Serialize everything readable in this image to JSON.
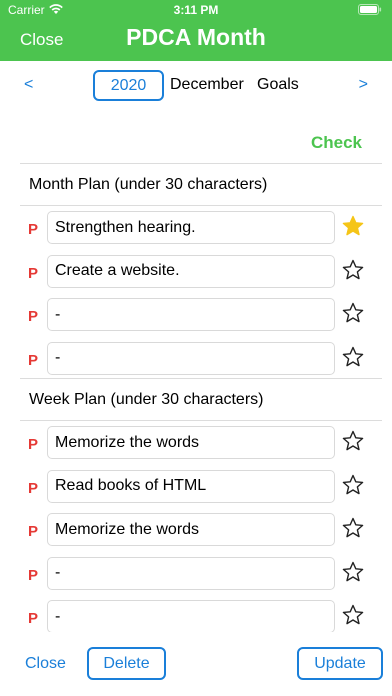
{
  "status_bar": {
    "carrier": "Carrier",
    "time": "3:11 PM"
  },
  "header": {
    "close_label": "Close",
    "title": "PDCA Month",
    "color": "#4cc44f"
  },
  "date_nav": {
    "prev": "<",
    "next": ">",
    "year": "2020",
    "month": "December",
    "goals": "Goals"
  },
  "check_label": "Check",
  "month_plan": {
    "title": "Month Plan (under 30 characters)",
    "items": [
      {
        "mark": "P",
        "text": "Strengthen hearing.",
        "starred": true
      },
      {
        "mark": "P",
        "text": "Create a website.",
        "starred": false
      },
      {
        "mark": "P",
        "text": "-",
        "starred": false
      },
      {
        "mark": "P",
        "text": "-",
        "starred": false
      }
    ]
  },
  "week_plan": {
    "title": "Week Plan (under 30 characters)",
    "items": [
      {
        "mark": "P",
        "text": "Memorize the words",
        "starred": false
      },
      {
        "mark": "P",
        "text": "Read books of HTML",
        "starred": false
      },
      {
        "mark": "P",
        "text": "Memorize the words",
        "starred": false
      },
      {
        "mark": "P",
        "text": "-",
        "starred": false
      },
      {
        "mark": "P",
        "text": "-",
        "starred": false
      }
    ]
  },
  "footer": {
    "close_label": "Close",
    "delete_label": "Delete",
    "update_label": "Update",
    "accent": "#1a7fd9"
  },
  "colors": {
    "p_mark": "#e53935",
    "star_filled": "#f5c518"
  }
}
